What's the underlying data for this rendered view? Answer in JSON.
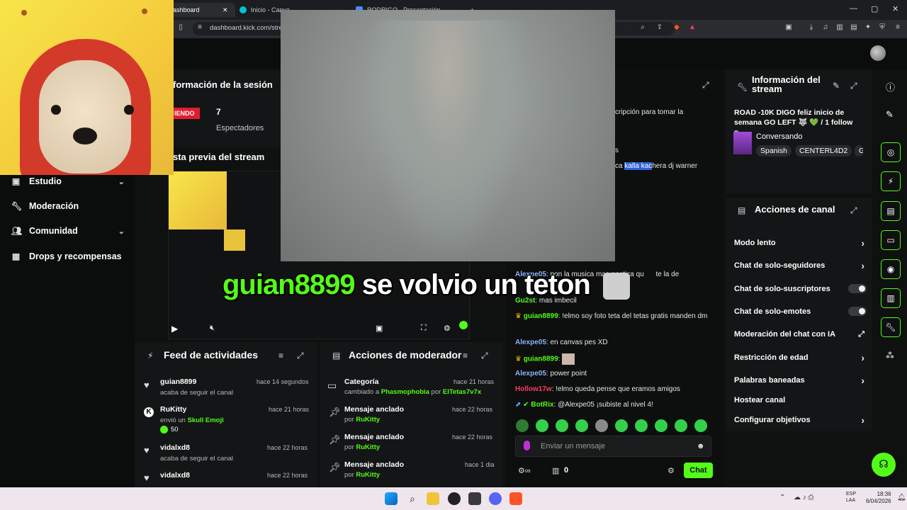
{
  "browser": {
    "tabs": [
      {
        "title": "ashboard",
        "active": true
      },
      {
        "title": "Inicio - Canva"
      },
      {
        "title": "RODRIGO - Presentación"
      }
    ],
    "url": "dashboard.kick.com/stre"
  },
  "sidebar": {
    "items": [
      {
        "label": "Estudio",
        "icon": "studio-icon",
        "chevron": true
      },
      {
        "label": "Moderación",
        "icon": "wrench-icon"
      },
      {
        "label": "Comunidad",
        "icon": "users-icon",
        "chevron": true
      },
      {
        "label": "Drops y recompensas",
        "icon": "drops-icon"
      }
    ]
  },
  "session": {
    "title": "formación de la sesión",
    "status": "IENDO",
    "viewers": "7",
    "viewers_label": "Espectadores"
  },
  "preview": {
    "title": "sta previa del stream"
  },
  "ticker": {
    "user": "guian8899",
    "text": "se volvio un teton"
  },
  "feed": {
    "title": "Feed de actividades",
    "items": [
      {
        "user": "guian8899",
        "time": "hace 14 segundos",
        "detail": "acaba de seguir el canal"
      },
      {
        "user": "RuKitty",
        "time": "hace 21 horas",
        "detail_prefix": "envió un",
        "detail_item": "Skull Emoji",
        "amount": "50"
      },
      {
        "user": "vidalxd8",
        "time": "hace 22 horas",
        "detail": "acaba de seguir el canal"
      },
      {
        "user": "vidalxd8",
        "time": "hace 22 horas"
      }
    ]
  },
  "modactions": {
    "title": "Acciones de moderador",
    "items": [
      {
        "title": "Categoría",
        "time": "hace 21 horas",
        "detail_prefix": "cambiado a",
        "target": "Phasmophobia",
        "by": "por",
        "by_user": "ElTetas7v7x"
      },
      {
        "title": "Mensaje anclado",
        "time": "hace 22 horas",
        "by": "por",
        "by_user": "RuKitty"
      },
      {
        "title": "Mensaje anclado",
        "time": "hace 22 horas",
        "by": "por",
        "by_user": "RuKitty"
      },
      {
        "title": "Mensaje anclado",
        "time": "hace 1 dia",
        "by": "por",
        "by_user": "RuKitty"
      }
    ]
  },
  "chat": {
    "partial_top": "cripción para tomar la",
    "partial_mid": "s",
    "partial_highlight_prefix": "ca",
    "partial_highlight": "kalla kac",
    "partial_highlight_rest": "hera dj warner",
    "messages": [
      {
        "user": "Alexpe05",
        "color": "#8ab4ff",
        "text": ": pon la musica mas poetica qu",
        "text2": "te la de"
      },
      {
        "user": "Gu2st",
        "color": "#53fc18",
        "text": ": mas imbecil"
      },
      {
        "user": "guian8899",
        "color": "#53fc18",
        "text": ": !elmo soy foto teta del tetas gratis manden dm"
      },
      {
        "user": "Alexpe05",
        "color": "#8ab4ff",
        "text": ": en canvas pes XD"
      },
      {
        "user": "guian8899",
        "color": "#53fc18",
        "text": ":"
      },
      {
        "user": "Alexpe05",
        "color": "#8ab4ff",
        "text": ": power point"
      },
      {
        "user": "Hollow17w",
        "color": "#ff3b5c",
        "text": ": !elmo queda pense que eramos amigos"
      },
      {
        "user": "BotRix",
        "color": "#53fc18",
        "text": ": @Alexpe05 ¡subiste al nivel 4!"
      }
    ],
    "input_placeholder": "Enviar un mensaje",
    "points": "0",
    "send_label": "Chat"
  },
  "stream_info": {
    "title": "Información del stream",
    "stream_title": "ROAD -10K DIGO feliz inicio de semana GO LEFT 🐺 💚 / 1 follow =...",
    "category": "Conversando",
    "tags": [
      "Spanish",
      "CENTERL4D2",
      "G"
    ]
  },
  "channel_actions": {
    "title": "Acciones de canal",
    "items": [
      {
        "label": "Modo lento",
        "control": "chevron"
      },
      {
        "label": "Chat de solo-seguidores",
        "control": "chevron"
      },
      {
        "label": "Chat de solo-suscriptores",
        "control": "toggle"
      },
      {
        "label": "Chat de solo-emotes",
        "control": "toggle"
      },
      {
        "label": "Moderación del chat con IA",
        "control": "external"
      },
      {
        "label": "Restricción de edad",
        "control": "chevron"
      },
      {
        "label": "Palabras baneadas",
        "control": "chevron"
      },
      {
        "label": "Hostear canal",
        "control": "none"
      },
      {
        "label": "Configurar objetivos",
        "control": "chevron"
      }
    ]
  },
  "taskbar": {
    "time": "18:36",
    "date": "6/04/2026",
    "lang": "ESP",
    "lang2": "LAA"
  },
  "colors": {
    "accent": "#53fc18",
    "bg": "#0b0c0c",
    "panel": "#141516"
  }
}
